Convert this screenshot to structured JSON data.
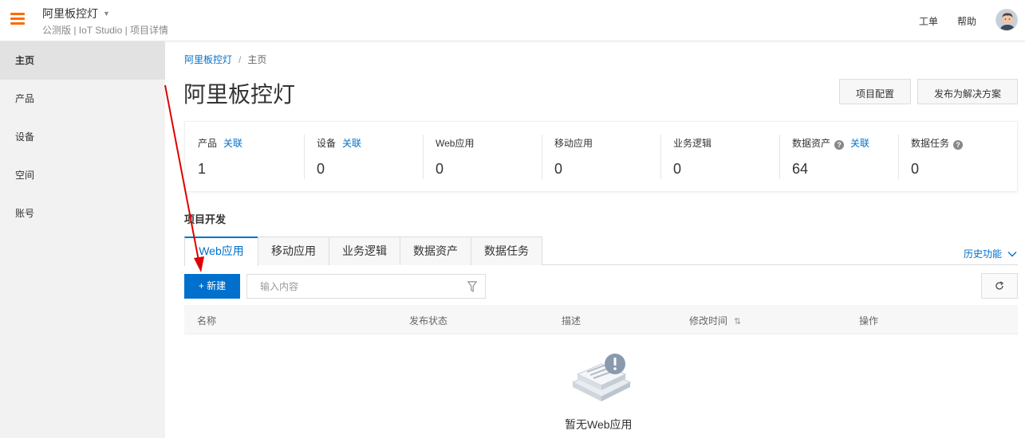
{
  "header": {
    "app_title": "阿里板控灯",
    "app_subtitle": "公测版 | IoT Studio | 项目详情",
    "ticket_label": "工单",
    "help_label": "帮助",
    "accent_color": "#ff6a00"
  },
  "sidebar": {
    "items": [
      {
        "label": "主页"
      },
      {
        "label": "产品"
      },
      {
        "label": "设备"
      },
      {
        "label": "空间"
      },
      {
        "label": "账号"
      }
    ]
  },
  "breadcrumb": {
    "project": "阿里板控灯",
    "separator": "/",
    "current": "主页"
  },
  "page": {
    "title": "阿里板控灯",
    "project_config_label": "项目配置",
    "publish_label": "发布为解决方案"
  },
  "stats": [
    {
      "label": "产品",
      "assoc": "关联",
      "value": "1"
    },
    {
      "label": "设备",
      "assoc": "关联",
      "value": "0"
    },
    {
      "label": "Web应用",
      "value": "0"
    },
    {
      "label": "移动应用",
      "value": "0"
    },
    {
      "label": "业务逻辑",
      "value": "0"
    },
    {
      "label": "数据资产",
      "help": "?",
      "assoc": "关联",
      "value": "64"
    },
    {
      "label": "数据任务",
      "help": "?",
      "value": "0"
    }
  ],
  "dev": {
    "section_title": "项目开发",
    "tabs": [
      "Web应用",
      "移动应用",
      "业务逻辑",
      "数据资产",
      "数据任务"
    ],
    "history_label": "历史功能",
    "new_button": "+ 新建",
    "search_placeholder": "输入内容",
    "columns": [
      "名称",
      "发布状态",
      "描述",
      "修改时间",
      "操作"
    ],
    "empty_text": "暂无Web应用"
  },
  "colors": {
    "primary": "#0070cc",
    "annotation_arrow": "#e00000"
  }
}
